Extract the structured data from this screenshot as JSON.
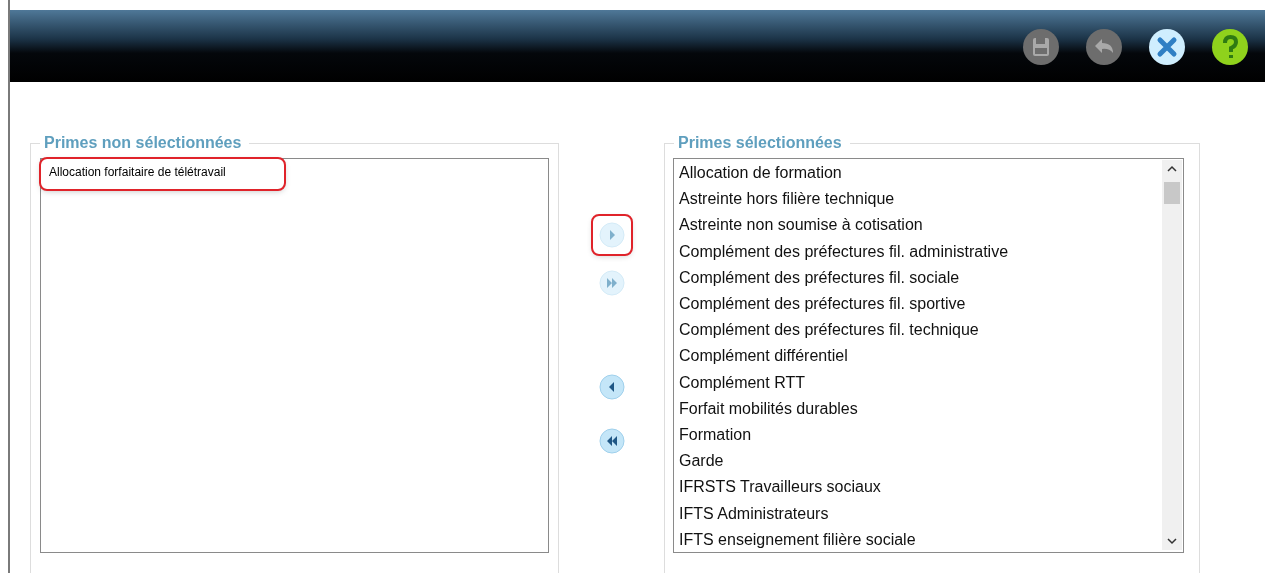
{
  "toolbar": {
    "buttons": [
      {
        "kind": "save",
        "disabled": true
      },
      {
        "kind": "undo",
        "disabled": true
      },
      {
        "kind": "close",
        "disabled": false
      },
      {
        "kind": "help",
        "disabled": false
      }
    ]
  },
  "unselected": {
    "legend": "Primes non sélectionnées",
    "items": [
      {
        "label": "Allocation forfaitaire de télétravail",
        "highlighted": true
      }
    ]
  },
  "transfer_buttons": [
    {
      "kind": "add",
      "disabled": true,
      "highlighted": true
    },
    {
      "kind": "add_all",
      "disabled": true,
      "highlighted": false
    },
    {
      "kind": "remove",
      "disabled": false,
      "highlighted": false
    },
    {
      "kind": "remove_all",
      "disabled": false,
      "highlighted": false
    }
  ],
  "selected": {
    "legend": "Primes sélectionnées",
    "items": [
      {
        "label": "Allocation de formation"
      },
      {
        "label": "Astreinte hors filière technique"
      },
      {
        "label": "Astreinte non soumise à cotisation"
      },
      {
        "label": "Complément des préfectures fil. administrative"
      },
      {
        "label": "Complément des préfectures fil. sociale"
      },
      {
        "label": "Complément des préfectures fil. sportive"
      },
      {
        "label": "Complément des préfectures fil. technique"
      },
      {
        "label": "Complément différentiel"
      },
      {
        "label": "Complément RTT"
      },
      {
        "label": "Forfait mobilités durables"
      },
      {
        "label": "Formation"
      },
      {
        "label": "Garde"
      },
      {
        "label": "IFRSTS Travailleurs sociaux"
      },
      {
        "label": "IFTS Administrateurs"
      },
      {
        "label": "IFTS enseignement filière sociale"
      }
    ]
  }
}
